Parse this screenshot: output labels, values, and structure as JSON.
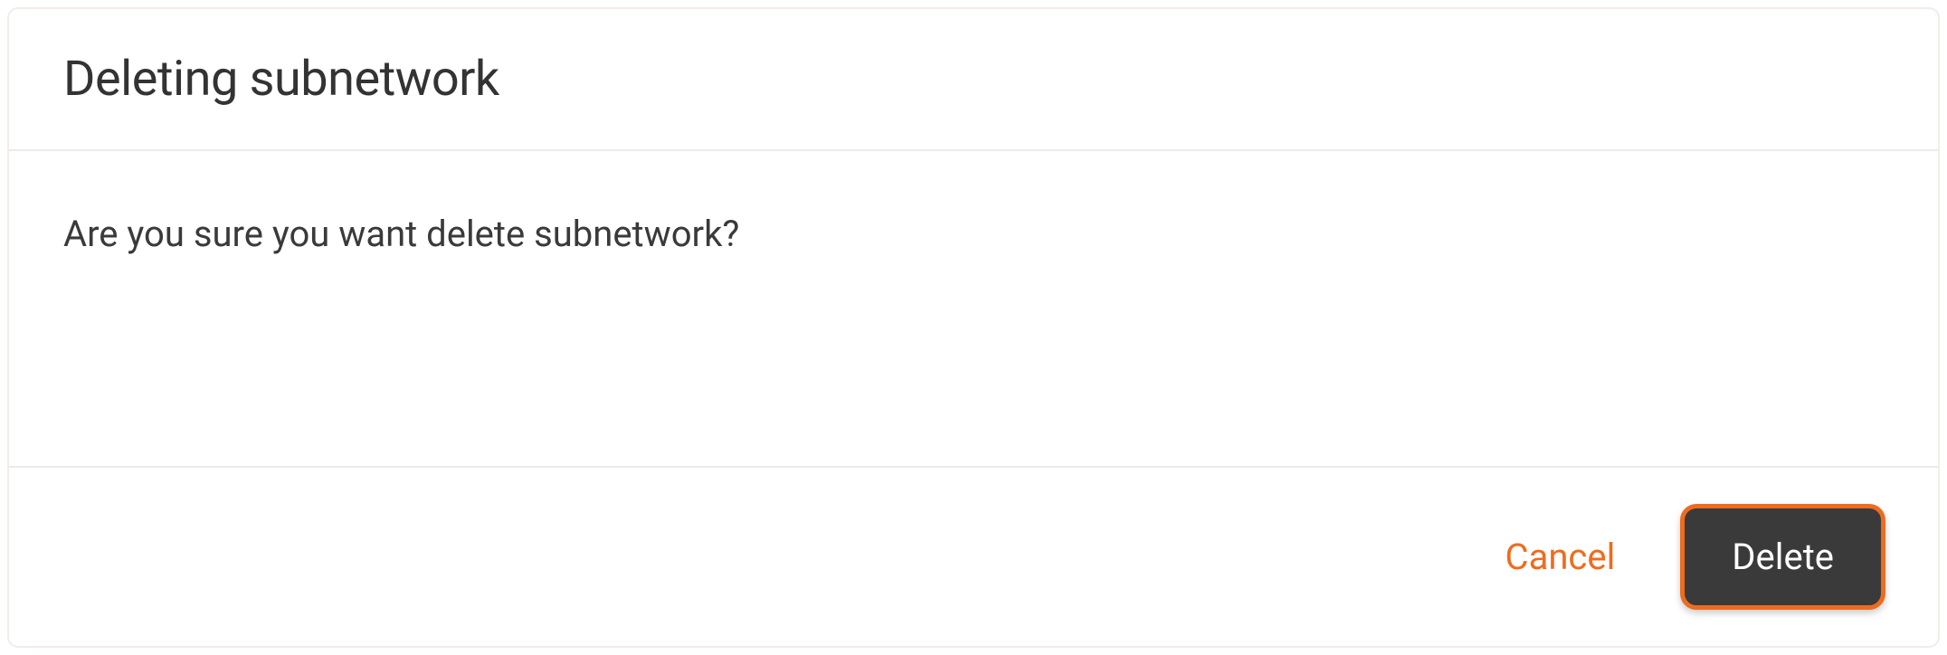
{
  "dialog": {
    "title": "Deleting subnetwork",
    "message": "Are you sure you want delete subnetwork?",
    "cancel_label": "Cancel",
    "delete_label": "Delete"
  }
}
